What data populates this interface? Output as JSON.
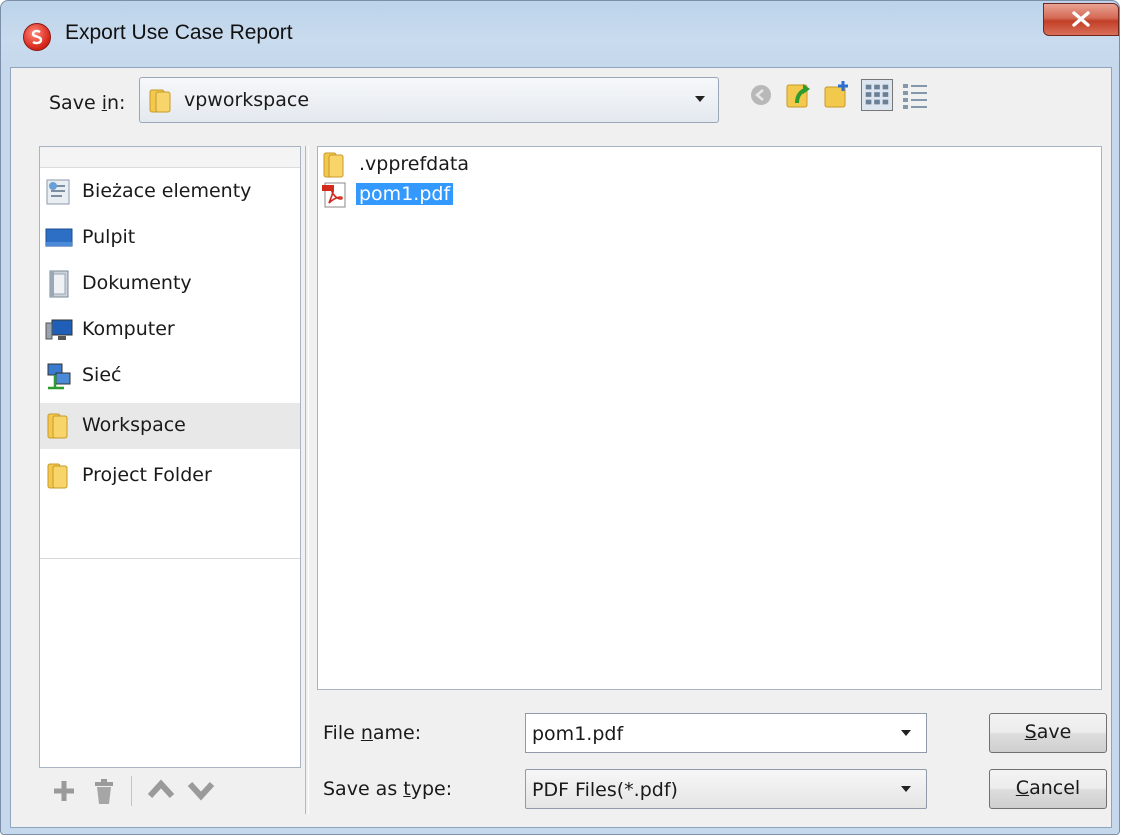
{
  "window": {
    "title": "Export Use Case Report"
  },
  "save_in": {
    "label_pre": "Save ",
    "label_acc": "i",
    "label_post": "n:",
    "value": "vpworkspace"
  },
  "toolbar": {
    "icons": [
      "back-icon",
      "up-one-level-icon",
      "create-new-folder-icon",
      "list-view-icon",
      "details-view-icon"
    ]
  },
  "sidebar": {
    "items": [
      {
        "label": "Bieżace elementy",
        "icon": "recent-items-icon"
      },
      {
        "label": "Pulpit",
        "icon": "desktop-icon"
      },
      {
        "label": "Dokumenty",
        "icon": "documents-icon"
      },
      {
        "label": "Komputer",
        "icon": "computer-icon"
      },
      {
        "label": "Sieć",
        "icon": "network-icon"
      },
      {
        "label": "Workspace",
        "icon": "folder-icon"
      },
      {
        "label": "Project Folder",
        "icon": "folder-icon"
      }
    ],
    "tools": [
      "add-icon",
      "delete-icon",
      "move-up-icon",
      "move-down-icon"
    ]
  },
  "files": [
    {
      "name": ".vpprefdata",
      "icon": "folder-icon"
    },
    {
      "name": "pom1.pdf",
      "icon": "pdf-file-icon",
      "selected": true
    }
  ],
  "file_name": {
    "label_pre": "File ",
    "label_acc": "n",
    "label_post": "ame:",
    "value": "pom1.pdf"
  },
  "save_as_type": {
    "label_pre": "Save as ",
    "label_acc": "t",
    "label_post": "ype:",
    "value": "PDF Files(*.pdf)"
  },
  "buttons": {
    "save_acc": "S",
    "save_rest": "ave",
    "cancel_acc": "C",
    "cancel_rest": "ancel"
  },
  "colors": {
    "selection": "#3399ff",
    "close_button": "#c8452c"
  }
}
